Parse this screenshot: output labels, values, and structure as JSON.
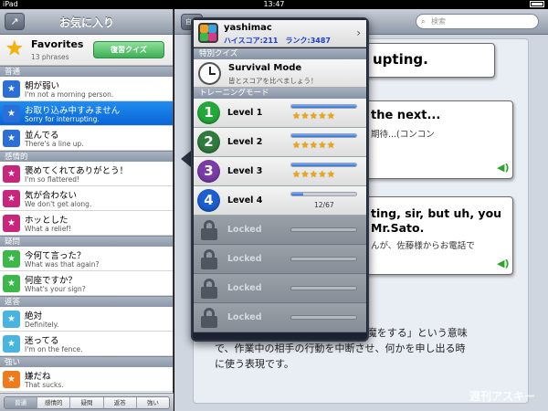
{
  "status": {
    "carrier": "iPad",
    "time": "13:47"
  },
  "left": {
    "nav_title": "お気に入り",
    "favorites": {
      "title": "Favorites",
      "count": "13 phrases",
      "quiz_button": "復習クイズ"
    },
    "sections": [
      {
        "header": "普通",
        "color": "#2a6fd8",
        "rows": [
          {
            "jp": "朝が弱い",
            "en": "I'm not a morning person.",
            "selected": false
          },
          {
            "jp": "お取り込み中すみません",
            "en": "Sorry for interrupting.",
            "selected": true
          },
          {
            "jp": "並んでる",
            "en": "There's a line up.",
            "selected": false
          }
        ]
      },
      {
        "header": "感情的",
        "color": "#c8267c",
        "rows": [
          {
            "jp": "褒めてくれてありがとう！",
            "en": "I'm so flattered!",
            "selected": false
          },
          {
            "jp": "気が合わない",
            "en": "We don't get along.",
            "selected": false
          },
          {
            "jp": "ホッとした",
            "en": "What a relief!",
            "selected": false
          }
        ]
      },
      {
        "header": "疑問",
        "color": "#3cb84a",
        "rows": [
          {
            "jp": "今何て言った？",
            "en": "What was that again?",
            "selected": false
          },
          {
            "jp": "何座ですか？",
            "en": "What's your sign?",
            "selected": false
          }
        ]
      },
      {
        "header": "返答",
        "color": "#48b4e0",
        "rows": [
          {
            "jp": "絶対",
            "en": "Definitely.",
            "selected": false
          },
          {
            "jp": "迷ってる",
            "en": "I'm on the fence.",
            "selected": false
          }
        ]
      },
      {
        "header": "強い",
        "color": "#f07a1a",
        "rows": [
          {
            "jp": "嫌だね",
            "en": "That sucks.",
            "selected": false
          }
        ]
      }
    ],
    "tabs": [
      "普通",
      "感情的",
      "疑問",
      "返答",
      "強い"
    ],
    "active_tab": 0
  },
  "right": {
    "back_label": "自動",
    "search_placeholder": "検索",
    "bubble1": "upting.",
    "bubble2_title": "the next...",
    "bubble2_sub": "期待...(コンコン",
    "bubble3_title1": "ting, sir, but uh, you",
    "bubble3_title2": "Mr.Sato.",
    "bubble3_sub": "んが、佐藤様からお電話で",
    "explanation_line1": "interrupt とは「作業中の人の邪魔をする」という意味",
    "explanation_line2": "で、作業中の相手の行動を中断させ、何かを申し出る時",
    "explanation_line3": "に使う表現です。",
    "watermark": "週刊アスキー"
  },
  "popover": {
    "user_name": "yashimac",
    "score_line": "ハイスコア:211　ランク:3487",
    "special_header": "特別クイズ",
    "survival_title": "Survival Mode",
    "survival_sub": "皆とスコアを比べましょう！",
    "training_header": "トレーニングモード",
    "levels": [
      {
        "num": "1",
        "name": "Level 1",
        "color": "#25a83a",
        "progress": 1.0,
        "stars": "★★★★★",
        "locked": false
      },
      {
        "num": "2",
        "name": "Level 2",
        "color": "#2f7c3e",
        "progress": 1.0,
        "stars": "★★★★★",
        "locked": false
      },
      {
        "num": "3",
        "name": "Level 3",
        "color": "#7a3ca8",
        "progress": 1.0,
        "stars": "★★★★★",
        "locked": false
      },
      {
        "num": "4",
        "name": "Level 4",
        "color": "#1c5fd0",
        "progress": 0.18,
        "progress_text": "12/67",
        "locked": false
      },
      {
        "name": "Locked",
        "progress": 0,
        "locked": true
      },
      {
        "name": "Locked",
        "progress": 0,
        "locked": true
      },
      {
        "name": "Locked",
        "progress": 0,
        "locked": true
      },
      {
        "name": "Locked",
        "progress": 0,
        "locked": true
      }
    ]
  }
}
